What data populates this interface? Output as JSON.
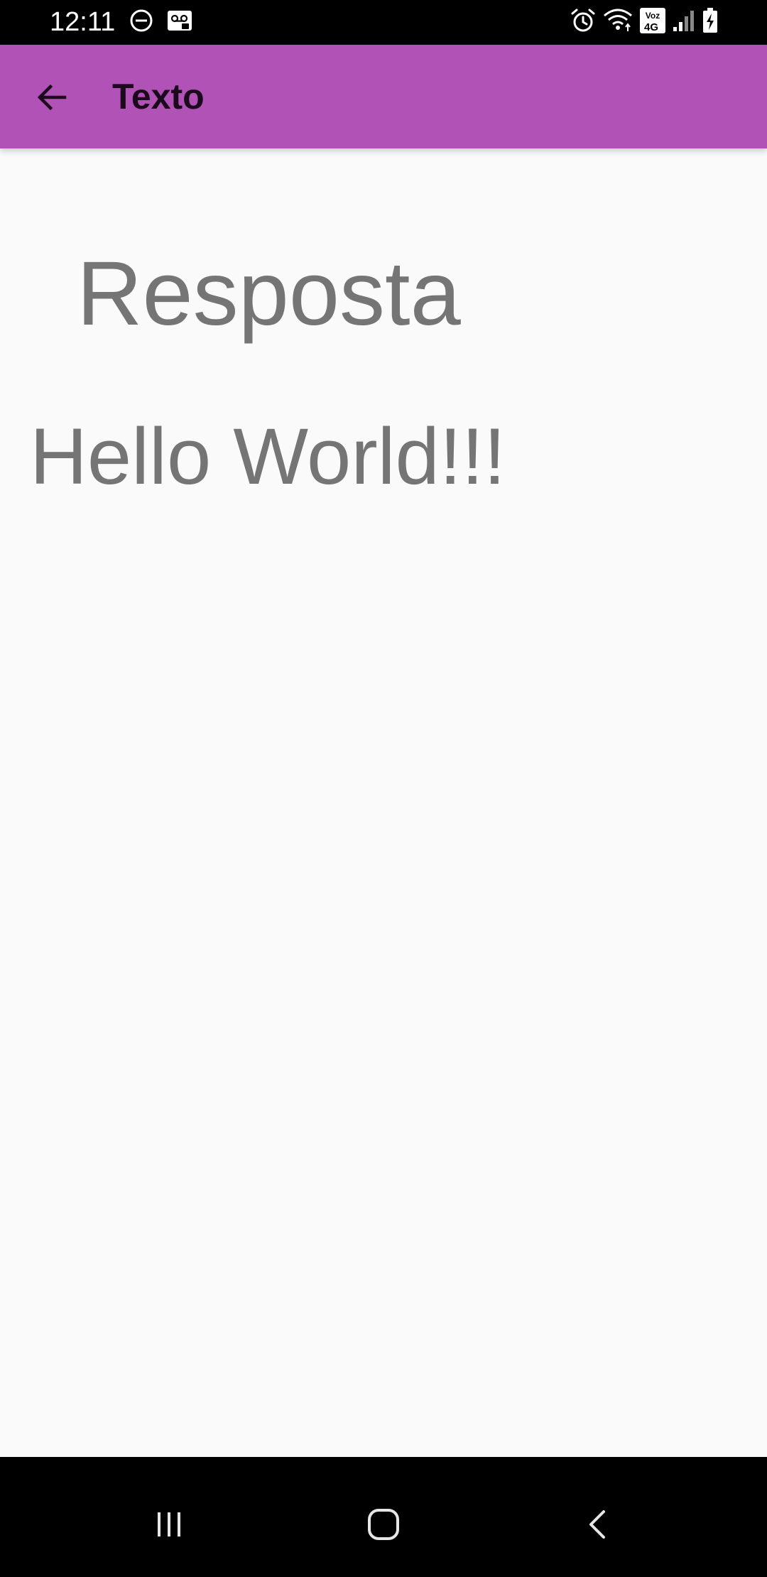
{
  "status_bar": {
    "time": "12:11",
    "icons": [
      "do-not-disturb-icon",
      "voicemail-icon",
      "alarm-icon",
      "wifi-icon",
      "volte-4g-icon",
      "signal-icon",
      "battery-charging-icon"
    ],
    "network_label": "Voz 4G"
  },
  "app_bar": {
    "title": "Texto",
    "back_icon": "arrow-back-icon",
    "color": "#b152b6"
  },
  "content": {
    "heading": "Resposta",
    "body": "Hello World!!!"
  },
  "nav_bar": {
    "buttons": [
      "recents-icon",
      "home-icon",
      "back-icon"
    ]
  }
}
